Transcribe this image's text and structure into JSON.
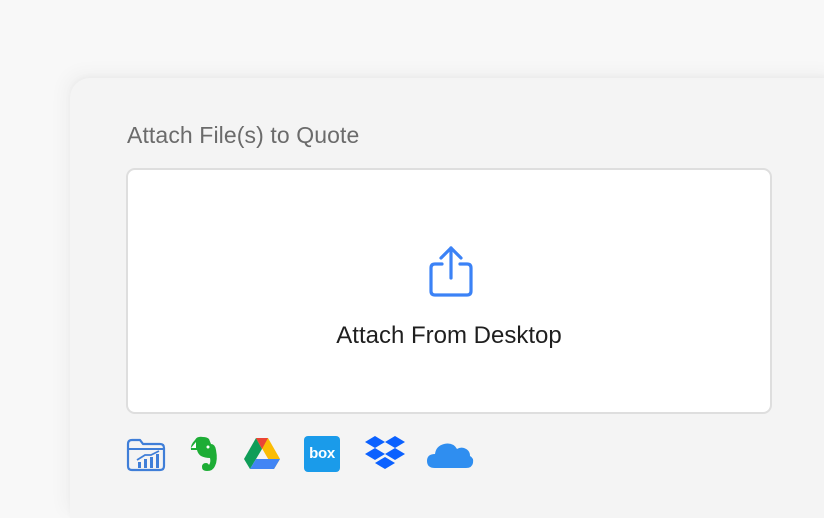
{
  "attach": {
    "section_label": "Attach File(s) to Quote",
    "dropzone_label": "Attach From Desktop"
  },
  "sources": [
    {
      "icon": "zoho-workdrive-icon"
    },
    {
      "icon": "evernote-icon"
    },
    {
      "icon": "google-drive-icon"
    },
    {
      "icon": "box-icon",
      "label": "box"
    },
    {
      "icon": "dropbox-icon"
    },
    {
      "icon": "onedrive-icon"
    }
  ],
  "colors": {
    "accent": "#3b82f6",
    "evernote": "#1dad35",
    "box": "#1a9bea",
    "dropbox": "#0b61ff",
    "onedrive": "#2f8ef0",
    "workdrive": "#3f7ed8"
  }
}
